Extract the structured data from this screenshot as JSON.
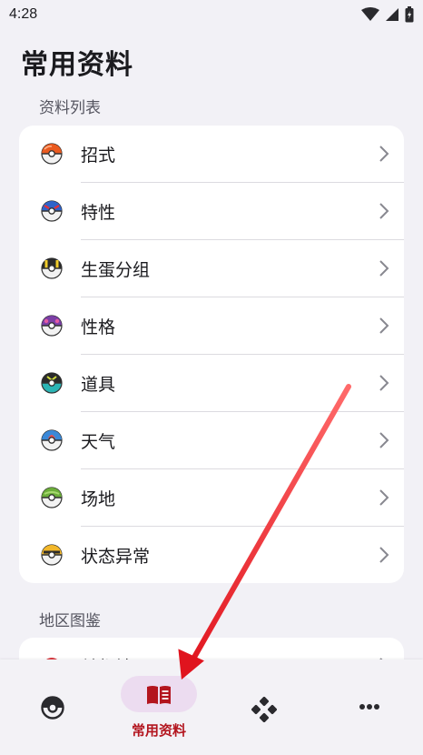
{
  "status": {
    "time": "4:28"
  },
  "page": {
    "title": "常用资料"
  },
  "sections": [
    {
      "title": "资料列表"
    },
    {
      "title": "地区图鉴"
    }
  ],
  "list": {
    "items": [
      {
        "label": "招式",
        "icon": "poke-ball-icon"
      },
      {
        "label": "特性",
        "icon": "great-ball-icon"
      },
      {
        "label": "生蛋分组",
        "icon": "ultra-ball-icon"
      },
      {
        "label": "性格",
        "icon": "master-ball-icon"
      },
      {
        "label": "道具",
        "icon": "dusk-ball-icon"
      },
      {
        "label": "天气",
        "icon": "dive-ball-icon"
      },
      {
        "label": "场地",
        "icon": "friend-ball-icon"
      },
      {
        "label": "状态异常",
        "icon": "quick-ball-icon"
      }
    ]
  },
  "region": {
    "partial_label": "关都地区"
  },
  "nav": {
    "items": [
      {
        "label": "",
        "icon": "pokeball-icon"
      },
      {
        "label": "常用资料",
        "icon": "book-icon",
        "active": true
      },
      {
        "label": "",
        "icon": "gamepad-icon"
      },
      {
        "label": "",
        "icon": "more-icon"
      }
    ]
  },
  "colors": {
    "accent": "#b3151e",
    "active_pill": "#ecdcf0",
    "background": "#f2f1f6",
    "annotation_arrow": "#e0141e"
  }
}
